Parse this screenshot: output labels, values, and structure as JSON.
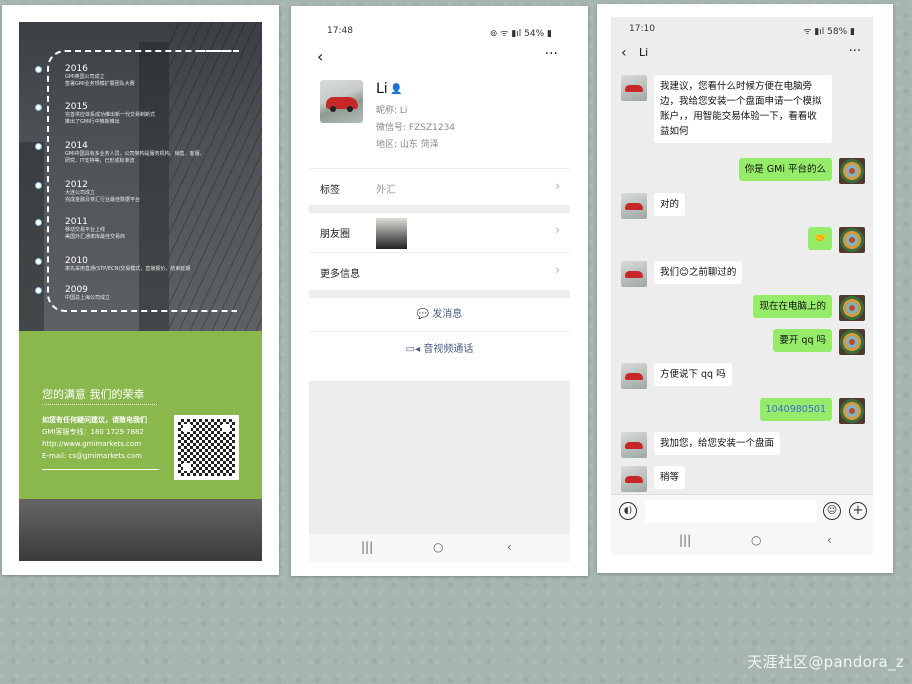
{
  "brochure": {
    "timeline": [
      {
        "year": "2016",
        "desc": [
          "GMI英国公司成立",
          "签署GMI业务规模扩展团队大赛"
        ]
      },
      {
        "year": "2015",
        "desc": [
          "完善供应体系成功推出新一代交易制新式",
          "推出了GMI行中推新推出"
        ]
      },
      {
        "year": "2014",
        "desc": [
          "GMI中国具有多业务人员，公司架构是服务机构、销售、客服、",
          "研究、IT支持等，已形成标准流"
        ]
      },
      {
        "year": "2012",
        "desc": [
          "大连公司成立",
          "完成金融及将汇行业最佳数据平台"
        ]
      },
      {
        "year": "2011",
        "desc": [
          "移动交易平台上线",
          "美国外汇通率库最佳交易商"
        ]
      },
      {
        "year": "2010",
        "desc": [
          "率先采用直通(STP/ECN)交易模式，直接报价，结束延期"
        ]
      },
      {
        "year": "2009",
        "desc": [
          "中国总上海公司成立"
        ]
      }
    ],
    "slogan": "您的满意  我们的荣幸",
    "contact": [
      "如您有任何疑问建议，请致电我们",
      "GMI客服专线：180 1729 7882",
      "http://www.gmimarkets.com",
      "E-mail: cs@gmimarkets.com"
    ]
  },
  "profile": {
    "time": "17:48",
    "status_icons": "⊚  ᯤ ▮ıl 54% ▮",
    "name": "Li",
    "nickname": "昵称: Li",
    "wechat_id": "微信号: FZSZ1234",
    "region": "地区: 山东  菏泽",
    "rows": {
      "tag_label": "标签",
      "tag_value": "外汇",
      "moments_label": "朋友圈",
      "more_label": "更多信息"
    },
    "actions": {
      "send_message": "发消息",
      "video_call": "音视频通话"
    }
  },
  "chat": {
    "time": "17:10",
    "status_icons": "ᯤ ▮ıl 58% ▮",
    "title": "Li",
    "messages": [
      {
        "side": "left",
        "text": "我建议，您看什么时候方便在电脑旁边，我给您安装一个盘面申请一个模拟账户，，用智能交易体验一下，看看收益如何"
      },
      {
        "side": "right",
        "text": "你是 GMi 平台的么"
      },
      {
        "side": "left",
        "text": "对的"
      },
      {
        "side": "right",
        "text": "🤝"
      },
      {
        "side": "left",
        "text": "我们😊之前聊过的"
      },
      {
        "side": "right",
        "text": "现在在电脑上的"
      },
      {
        "side": "right",
        "text": "要开 qq 吗"
      },
      {
        "side": "left",
        "text": "方便说下 qq 吗"
      },
      {
        "side": "right",
        "text": "1040980501"
      },
      {
        "side": "left",
        "text": "我加您，给您安装一个盘面"
      },
      {
        "side": "left",
        "text": "稍等"
      }
    ],
    "qq_color": "#3a6fd8"
  },
  "navbar": {
    "recent": "|||",
    "home": "○",
    "back": "‹"
  },
  "watermark": "天涯社区@pandora_z"
}
